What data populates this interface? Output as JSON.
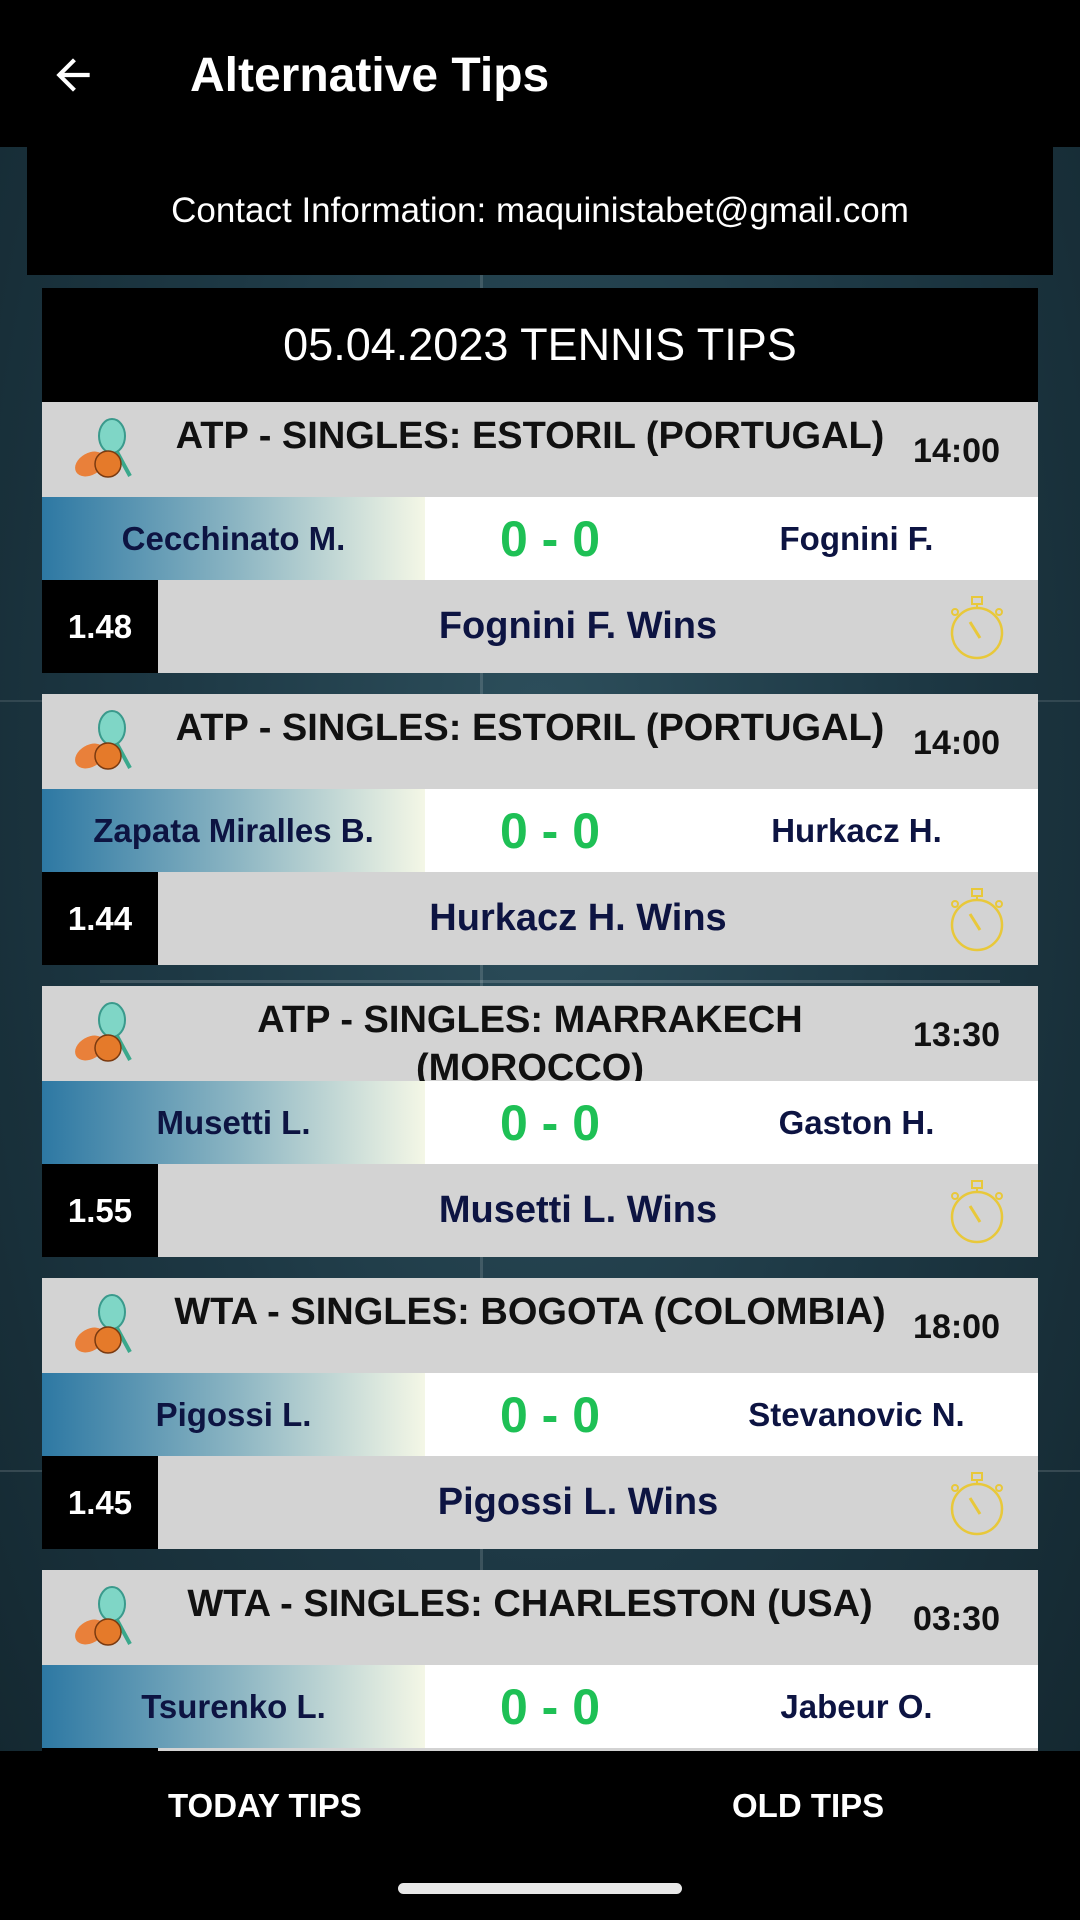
{
  "appbar": {
    "title": "Alternative Tips",
    "back_icon": "arrow-left-icon"
  },
  "contact": "Contact Information: maquinistabet@gmail.com",
  "day_header": "05.04.2023 TENNIS TIPS",
  "colors": {
    "score": "#1ec055",
    "player": "#0d1442",
    "watch": "#e8c83a"
  },
  "tips": [
    {
      "league": "ATP - SINGLES: ESTORIL (PORTUGAL)",
      "time": "14:00",
      "player1": "Cecchinato M.",
      "score": "0 - 0",
      "player2": "Fognini F.",
      "odds": "1.48",
      "pick": "Fognini F. Wins"
    },
    {
      "league": "ATP - SINGLES: ESTORIL (PORTUGAL)",
      "time": "14:00",
      "player1": "Zapata Miralles B.",
      "score": "0 - 0",
      "player2": "Hurkacz H.",
      "odds": "1.44",
      "pick": "Hurkacz H. Wins"
    },
    {
      "league": "ATP - SINGLES: MARRAKECH (MOROCCO)",
      "time": "13:30",
      "player1": "Musetti L.",
      "score": "0 - 0",
      "player2": "Gaston H.",
      "odds": "1.55",
      "pick": "Musetti L. Wins"
    },
    {
      "league": "WTA - SINGLES: BOGOTA (COLOMBIA)",
      "time": "18:00",
      "player1": "Pigossi L.",
      "score": "0 - 0",
      "player2": "Stevanovic N.",
      "odds": "1.45",
      "pick": "Pigossi L. Wins"
    },
    {
      "league": "WTA - SINGLES: CHARLESTON (USA)",
      "time": "03:30",
      "player1": "Tsurenko L.",
      "score": "0 - 0",
      "player2": "Jabeur O.",
      "odds": "",
      "pick": ""
    }
  ],
  "nav": {
    "today": "TODAY TIPS",
    "old": "OLD TIPS"
  }
}
